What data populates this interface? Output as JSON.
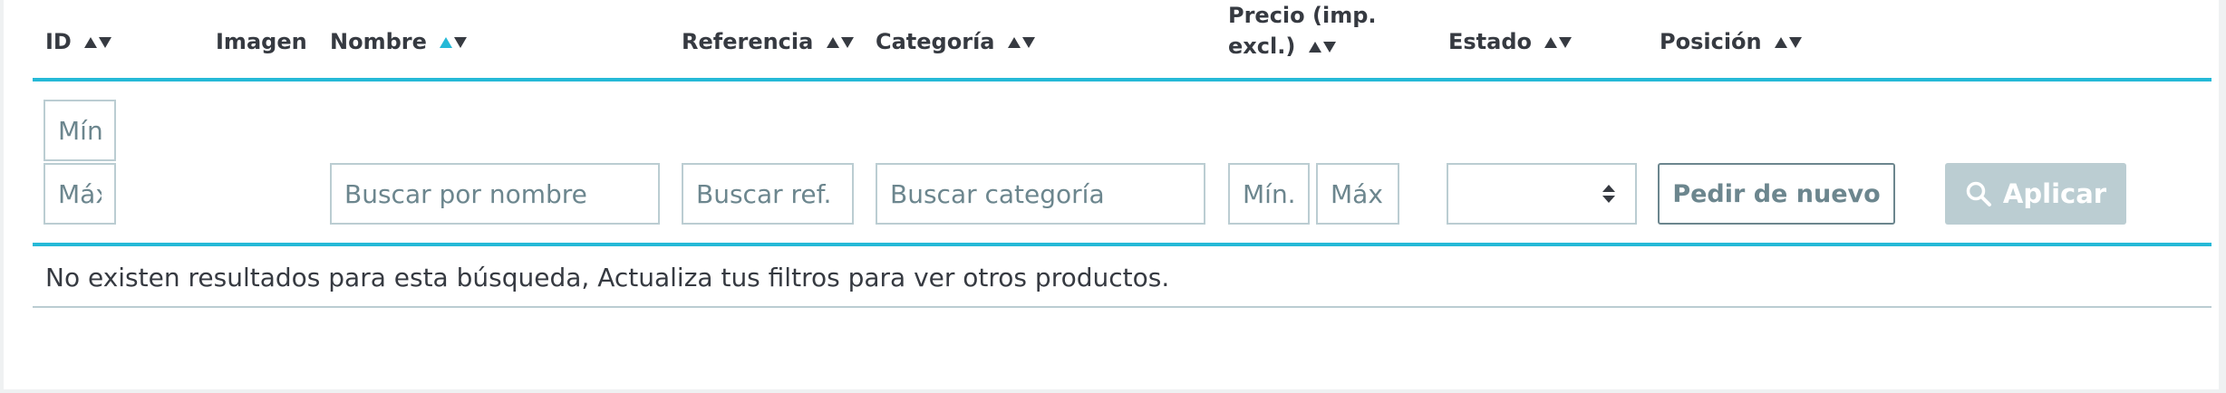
{
  "headers": {
    "id": "ID",
    "image": "Imagen",
    "name": "Nombre",
    "reference": "Referencia",
    "category": "Categoría",
    "price_line1": "Precio (imp.",
    "price_line2": "excl.)",
    "status": "Estado",
    "position": "Posición"
  },
  "filters": {
    "id_min_placeholder": "Mín",
    "id_max_placeholder": "Máx",
    "name_placeholder": "Buscar por nombre",
    "reference_placeholder": "Buscar ref.",
    "category_placeholder": "Buscar categoría",
    "price_min_placeholder": "Mín.",
    "price_max_placeholder": "Máx.",
    "status_value": "",
    "reorder_label": "Pedir de nuevo",
    "apply_label": "Aplicar"
  },
  "message": "No existen resultados para esta búsqueda, Actualiza tus filtros para ver otros productos.",
  "colors": {
    "accent": "#25b9d7",
    "border": "#bbcdd2",
    "text": "#363a41",
    "muted": "#6c868e"
  },
  "icons": {
    "sort": "sort-arrows-icon",
    "search": "search-icon",
    "select_caret": "select-caret-icon"
  }
}
